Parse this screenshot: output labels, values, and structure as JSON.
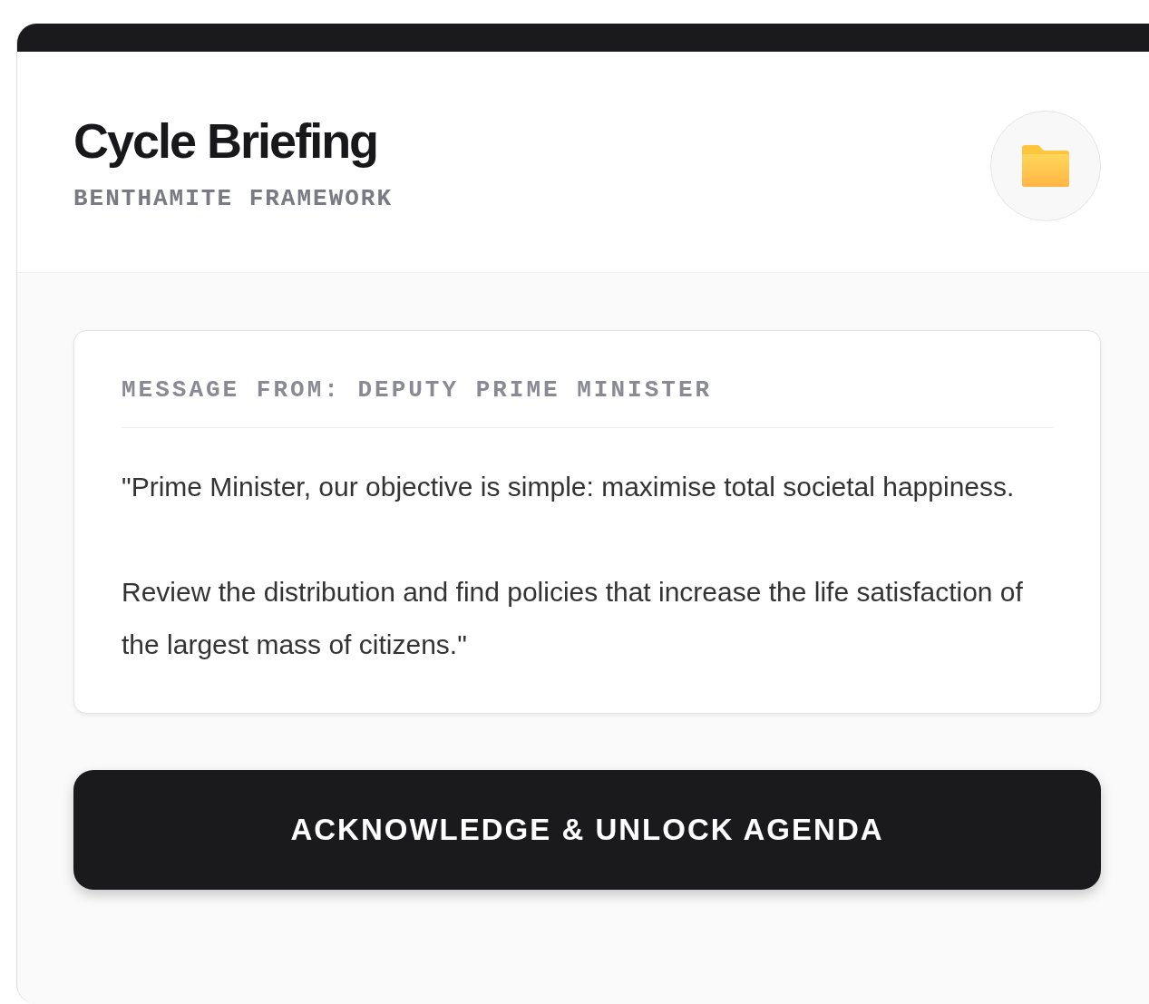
{
  "header": {
    "title": "Cycle Briefing",
    "subtitle": "BENTHAMITE FRAMEWORK"
  },
  "message": {
    "sender": "MESSAGE FROM: DEPUTY PRIME MINISTER",
    "paragraphs": [
      "\"Prime Minister, our objective is simple: maximise total societal happiness.",
      "Review the distribution and find policies that increase the life satisfaction of the largest mass of citizens.\""
    ]
  },
  "action_button": "ACKNOWLEDGE & UNLOCK AGENDA"
}
